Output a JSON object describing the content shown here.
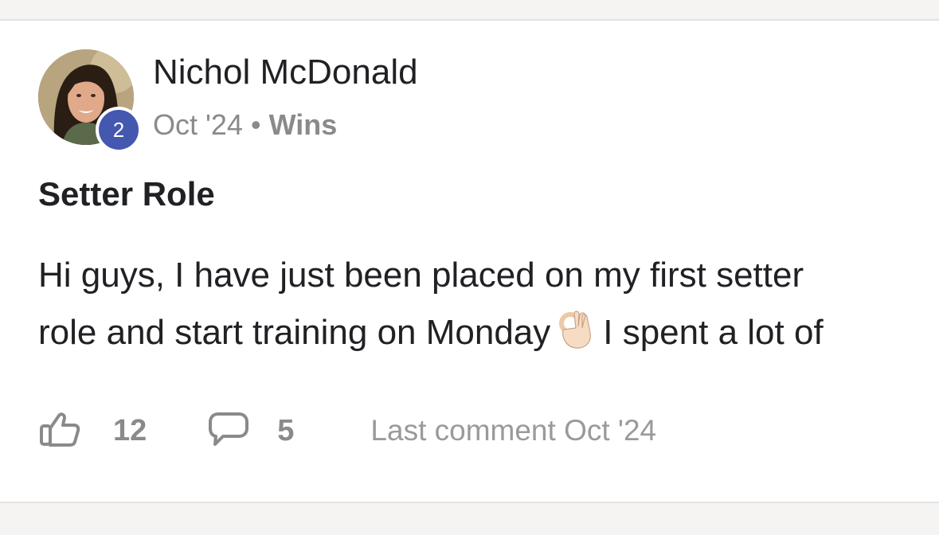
{
  "post": {
    "author": {
      "name": "Nichol McDonald",
      "level": "2"
    },
    "date": "Oct '24",
    "separator": "•",
    "category": "Wins",
    "title": "Setter Role",
    "body_line1": "Hi guys, I have just been placed on my first setter",
    "body_line2_before": "role and start training on Monday",
    "body_emoji": "ok-hand-emoji",
    "body_line2_after": "I spent a lot of",
    "likes": "12",
    "comments": "5",
    "last_comment": "Last comment Oct '24"
  },
  "colors": {
    "badge": "#4458b0",
    "text_primary": "#202124",
    "text_muted": "#8a8a8a",
    "page_bg": "#f5f4f2",
    "card_bg": "#ffffff"
  },
  "icons": {
    "like": "thumbs-up-icon",
    "comment": "speech-bubble-icon"
  }
}
